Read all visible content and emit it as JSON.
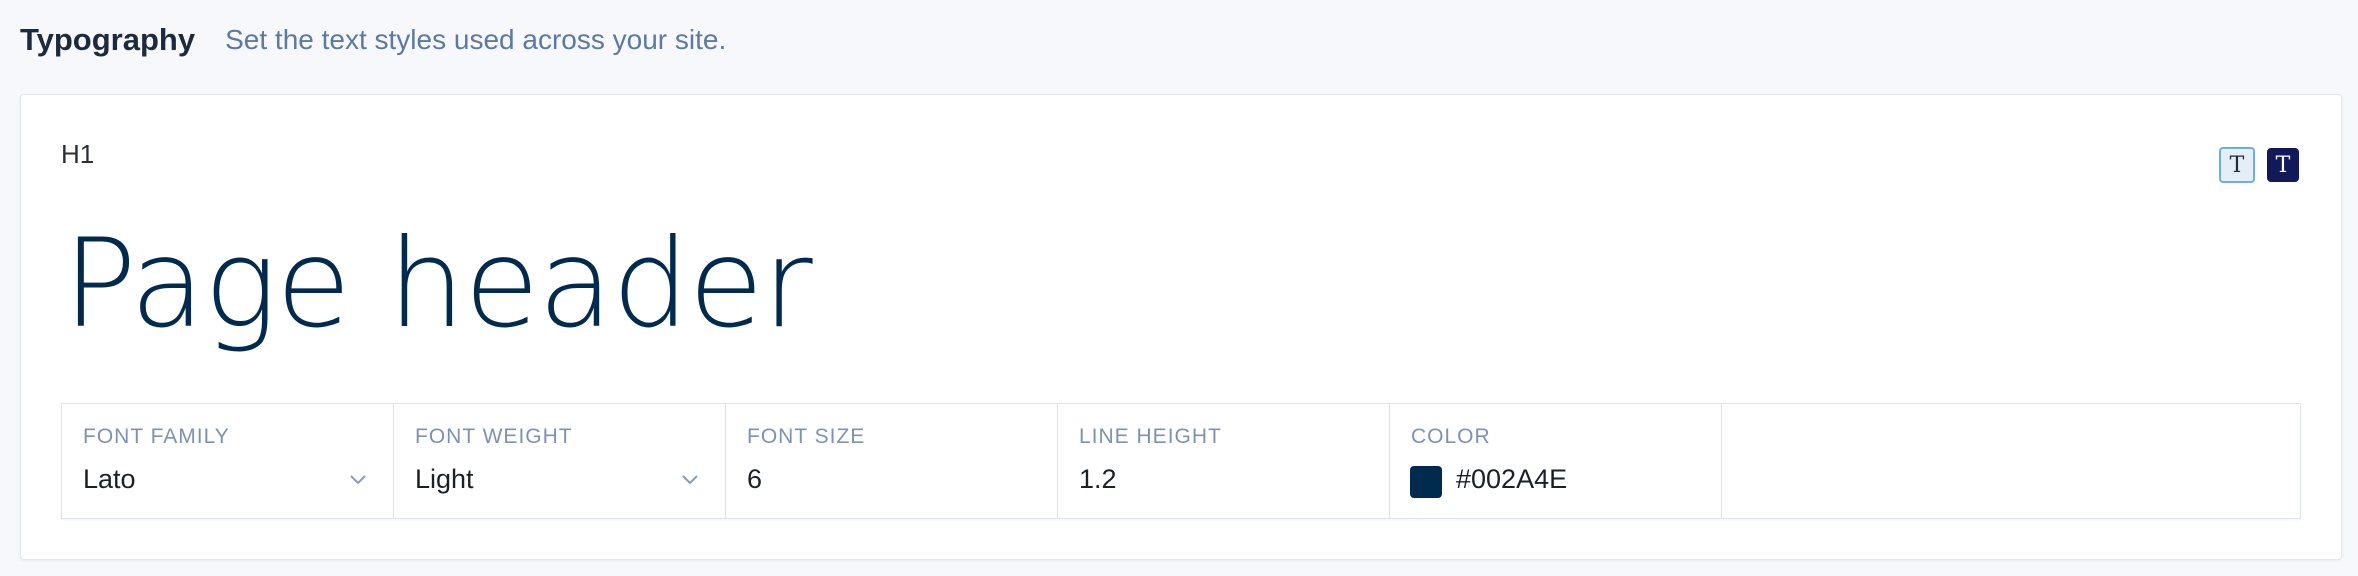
{
  "header": {
    "title": "Typography",
    "subtitle": "Set the text styles used across your site."
  },
  "style": {
    "label": "H1",
    "preview_text": "Page header",
    "toggle_light_icon": "T",
    "toggle_dark_icon": "T"
  },
  "properties": {
    "font_family": {
      "label": "FONT FAMILY",
      "value": "Lato"
    },
    "font_weight": {
      "label": "FONT WEIGHT",
      "value": "Light"
    },
    "font_size": {
      "label": "FONT SIZE",
      "value": "6"
    },
    "line_height": {
      "label": "LINE HEIGHT",
      "value": "1.2"
    },
    "color": {
      "label": "COLOR",
      "value": "#002A4E",
      "swatch": "#002A4E"
    }
  },
  "colors": {
    "accent": "#002A4E",
    "page_bg": "#f7f8fb",
    "label": "#7d92b3"
  }
}
